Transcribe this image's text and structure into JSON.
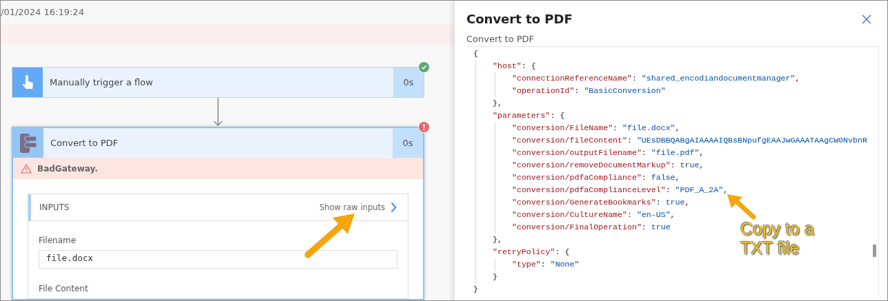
{
  "run": {
    "timestamp": "/01/2024 16:19:24"
  },
  "flow": {
    "steps": [
      {
        "title": "Manually trigger a flow",
        "duration": "0s",
        "failed": false,
        "kind": "trigger",
        "selected": false
      },
      {
        "title": "Convert to PDF",
        "duration": "0s",
        "failed": true,
        "kind": "action",
        "selected": true,
        "error": "BadGateway.",
        "inputs": {
          "heading": "INPUTS",
          "raw_link": "Show raw inputs",
          "fields": [
            {
              "label": "Filename",
              "value": "file.docx"
            },
            {
              "label": "File Content"
            }
          ]
        }
      }
    ]
  },
  "panel": {
    "title": "Convert to PDF",
    "subtitle": "Convert to PDF",
    "code": {
      "open": "{",
      "close": "}",
      "children": [
        {
          "key": "\"host\"",
          "sep": ": ",
          "open": "{",
          "close": "},",
          "children": [
            {
              "key": "\"connectionReferenceName\"",
              "sep": ": ",
              "value": "\"shared_encodiandocumentmanager\"",
              "end": ","
            },
            {
              "key": "\"operationId\"",
              "sep": ": ",
              "value": "\"BasicConversion\""
            }
          ]
        },
        {
          "key": "\"parameters\"",
          "sep": ": ",
          "open": "{",
          "close": "},",
          "children": [
            {
              "key": "\"conversion/FileName\"",
              "sep": ": ",
              "value": "\"file.docx\"",
              "end": ","
            },
            {
              "key": "\"conversion/fileContent\"",
              "sep": ": ",
              "value": "\"UEsDBBQABgAIAAAAIQBsBNpufgEAAJwGAAATAAgCW0NvbnR"
            },
            {
              "key": "\"conversion/outputFilename\"",
              "sep": ": ",
              "value": "\"file.pdf\"",
              "end": ","
            },
            {
              "key": "\"conversion/removeDocumentMarkup\"",
              "sep": ": ",
              "value": "true",
              "end": ","
            },
            {
              "key": "\"conversion/pdfaCompliance\"",
              "sep": ": ",
              "value": "false",
              "end": ","
            },
            {
              "key": "\"conversion/pdfaComplianceLevel\"",
              "sep": ": ",
              "value": "\"PDF_A_2A\"",
              "end": ","
            },
            {
              "key": "\"conversion/GenerateBookmarks\"",
              "sep": ": ",
              "value": "true",
              "end": ","
            },
            {
              "key": "\"conversion/CultureName\"",
              "sep": ": ",
              "value": "\"en-US\"",
              "end": ","
            },
            {
              "key": "\"conversion/FinalOperation\"",
              "sep": ": ",
              "value": "true"
            }
          ]
        },
        {
          "key": "\"retryPolicy\"",
          "sep": ": ",
          "open": "{",
          "close": "}",
          "children": [
            {
              "key": "\"type\"",
              "sep": ": ",
              "value": "\"None\""
            }
          ]
        }
      ]
    }
  },
  "annotation": {
    "callout": "Copy to a TXT file"
  }
}
